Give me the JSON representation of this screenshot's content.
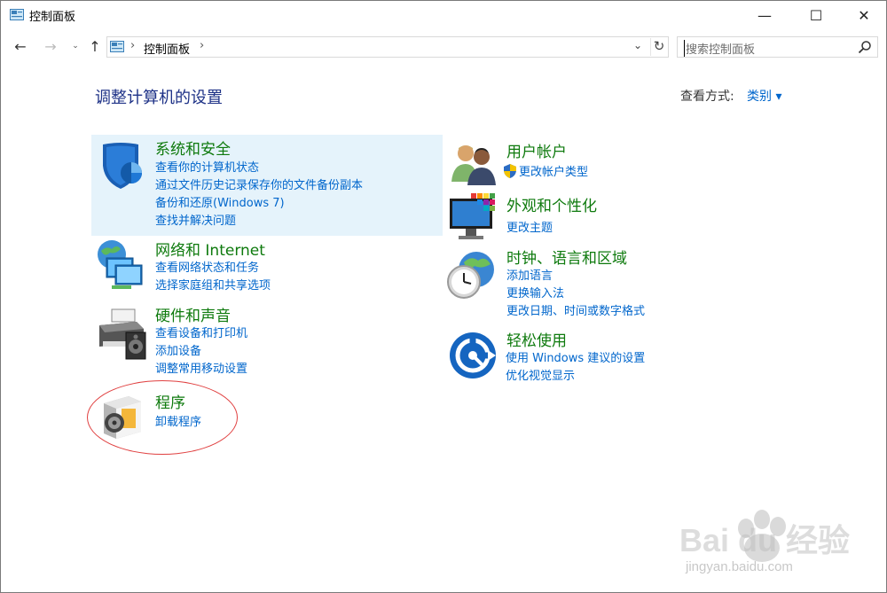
{
  "window": {
    "title": "控制面板",
    "minimize": "—",
    "maximize": "☐",
    "close": "✕"
  },
  "nav": {
    "back": "←",
    "forward": "→",
    "recent": "⌄",
    "up": "↑",
    "breadcrumb": "控制面板",
    "separator": "›",
    "dropdown": "⌄",
    "refresh": "↻",
    "search_placeholder": "搜索控制面板"
  },
  "header": {
    "title": "调整计算机的设置",
    "view_by_label": "查看方式:",
    "view_by_value": "类别 ▾"
  },
  "categories": {
    "system": {
      "title": "系统和安全",
      "links": [
        "查看你的计算机状态",
        "通过文件历史记录保存你的文件备份副本",
        "备份和还原(Windows 7)",
        "查找并解决问题"
      ]
    },
    "network": {
      "title": "网络和 Internet",
      "links": [
        "查看网络状态和任务",
        "选择家庭组和共享选项"
      ]
    },
    "hardware": {
      "title": "硬件和声音",
      "links": [
        "查看设备和打印机",
        "添加设备",
        "调整常用移动设置"
      ]
    },
    "programs": {
      "title": "程序",
      "links": [
        "卸载程序"
      ]
    },
    "users": {
      "title": "用户帐户",
      "links": [
        "更改帐户类型"
      ]
    },
    "appearance": {
      "title": "外观和个性化",
      "links": [
        "更改主题"
      ]
    },
    "clock": {
      "title": "时钟、语言和区域",
      "links": [
        "添加语言",
        "更换输入法",
        "更改日期、时间或数字格式"
      ]
    },
    "ease": {
      "title": "轻松使用",
      "links": [
        "使用 Windows 建议的设置",
        "优化视觉显示"
      ]
    }
  },
  "watermark": {
    "brand": "Bai du 经验",
    "url": "jingyan.baidu.com"
  },
  "colors": {
    "category_title": "#0e7a0d",
    "link": "#0066cc",
    "heading": "#1e3287",
    "highlight": "#e5f3fb",
    "annotation": "#e04040"
  }
}
